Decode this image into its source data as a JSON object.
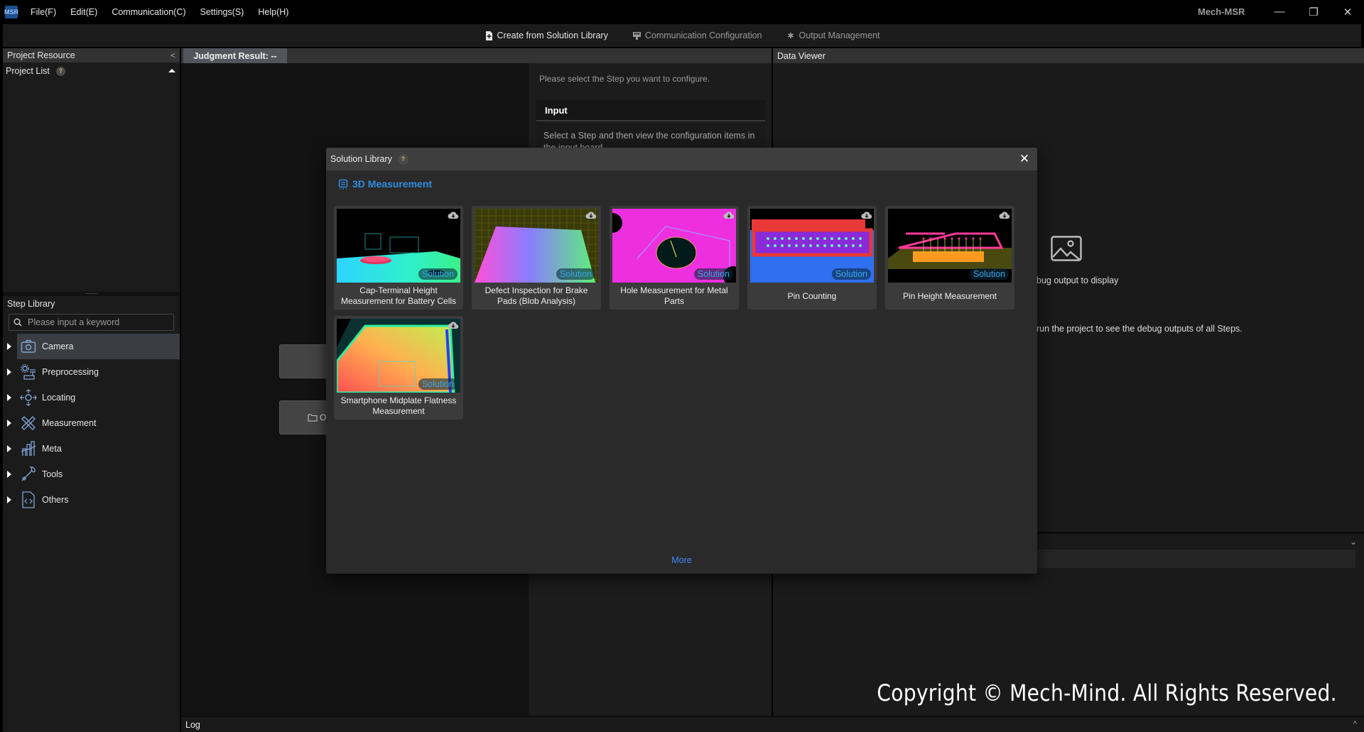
{
  "app": {
    "logo_text": "MSR",
    "title": "Mech-MSR",
    "menu": [
      "File(F)",
      "Edit(E)",
      "Communication(C)",
      "Settings(S)",
      "Help(H)"
    ],
    "window_controls": {
      "minimize": "—",
      "restore": "❐",
      "close": "✕"
    }
  },
  "toolbar": {
    "items": [
      {
        "label": "Create from Solution Library",
        "icon": "add-file-icon",
        "enabled": true
      },
      {
        "label": "Communication Configuration",
        "icon": "plug-icon",
        "enabled": false
      },
      {
        "label": "Output Management",
        "icon": "gear-icon",
        "enabled": false
      }
    ]
  },
  "left_panel": {
    "header": "Project Resource",
    "project_list_label": "Project List",
    "help": "?",
    "step_library": {
      "title": "Step Library",
      "search_placeholder": "Please input a keyword",
      "categories": [
        {
          "label": "Camera",
          "icon": "camera-icon",
          "selected": true
        },
        {
          "label": "Preprocessing",
          "icon": "preprocessing-icon",
          "selected": false
        },
        {
          "label": "Locating",
          "icon": "locating-icon",
          "selected": false
        },
        {
          "label": "Measurement",
          "icon": "measurement-icon",
          "selected": false
        },
        {
          "label": "Meta",
          "icon": "meta-icon",
          "selected": false
        },
        {
          "label": "Tools",
          "icon": "wrench-icon",
          "selected": false
        },
        {
          "label": "Others",
          "icon": "code-file-icon",
          "selected": false
        }
      ]
    }
  },
  "center": {
    "judgment_tab": "Judgment Result: --",
    "canvas_buttons": [
      "+",
      "Op"
    ],
    "config": {
      "hint": "Please select the Step you want to configure.",
      "input_title": "Input",
      "input_body": "Select a Step and then view the configuration items in the input board."
    }
  },
  "data_viewer": {
    "header": "Data Viewer",
    "msg1": "bug output to display",
    "msg2": "run the project to see the debug outputs of all Steps.",
    "copyright": "Copyright © Mech-Mind. All Rights Reserved."
  },
  "log": {
    "label": "Log"
  },
  "dialog": {
    "title": "Solution Library",
    "help": "?",
    "close": "✕",
    "category": "3D Measurement",
    "badge": "Solution",
    "more": "More",
    "solutions": [
      {
        "title": "Cap-Terminal Height Measurement for Battery Cells",
        "thumb": "battery"
      },
      {
        "title": "Defect Inspection for Brake Pads (Blob Analysis)",
        "thumb": "brake"
      },
      {
        "title": "Hole Measurement for Metal Parts",
        "thumb": "hole"
      },
      {
        "title": "Pin Counting",
        "thumb": "pincount"
      },
      {
        "title": "Pin Height Measurement",
        "thumb": "pinheight"
      },
      {
        "title": "Smartphone Midplate Flatness Measurement",
        "thumb": "phone"
      }
    ]
  }
}
